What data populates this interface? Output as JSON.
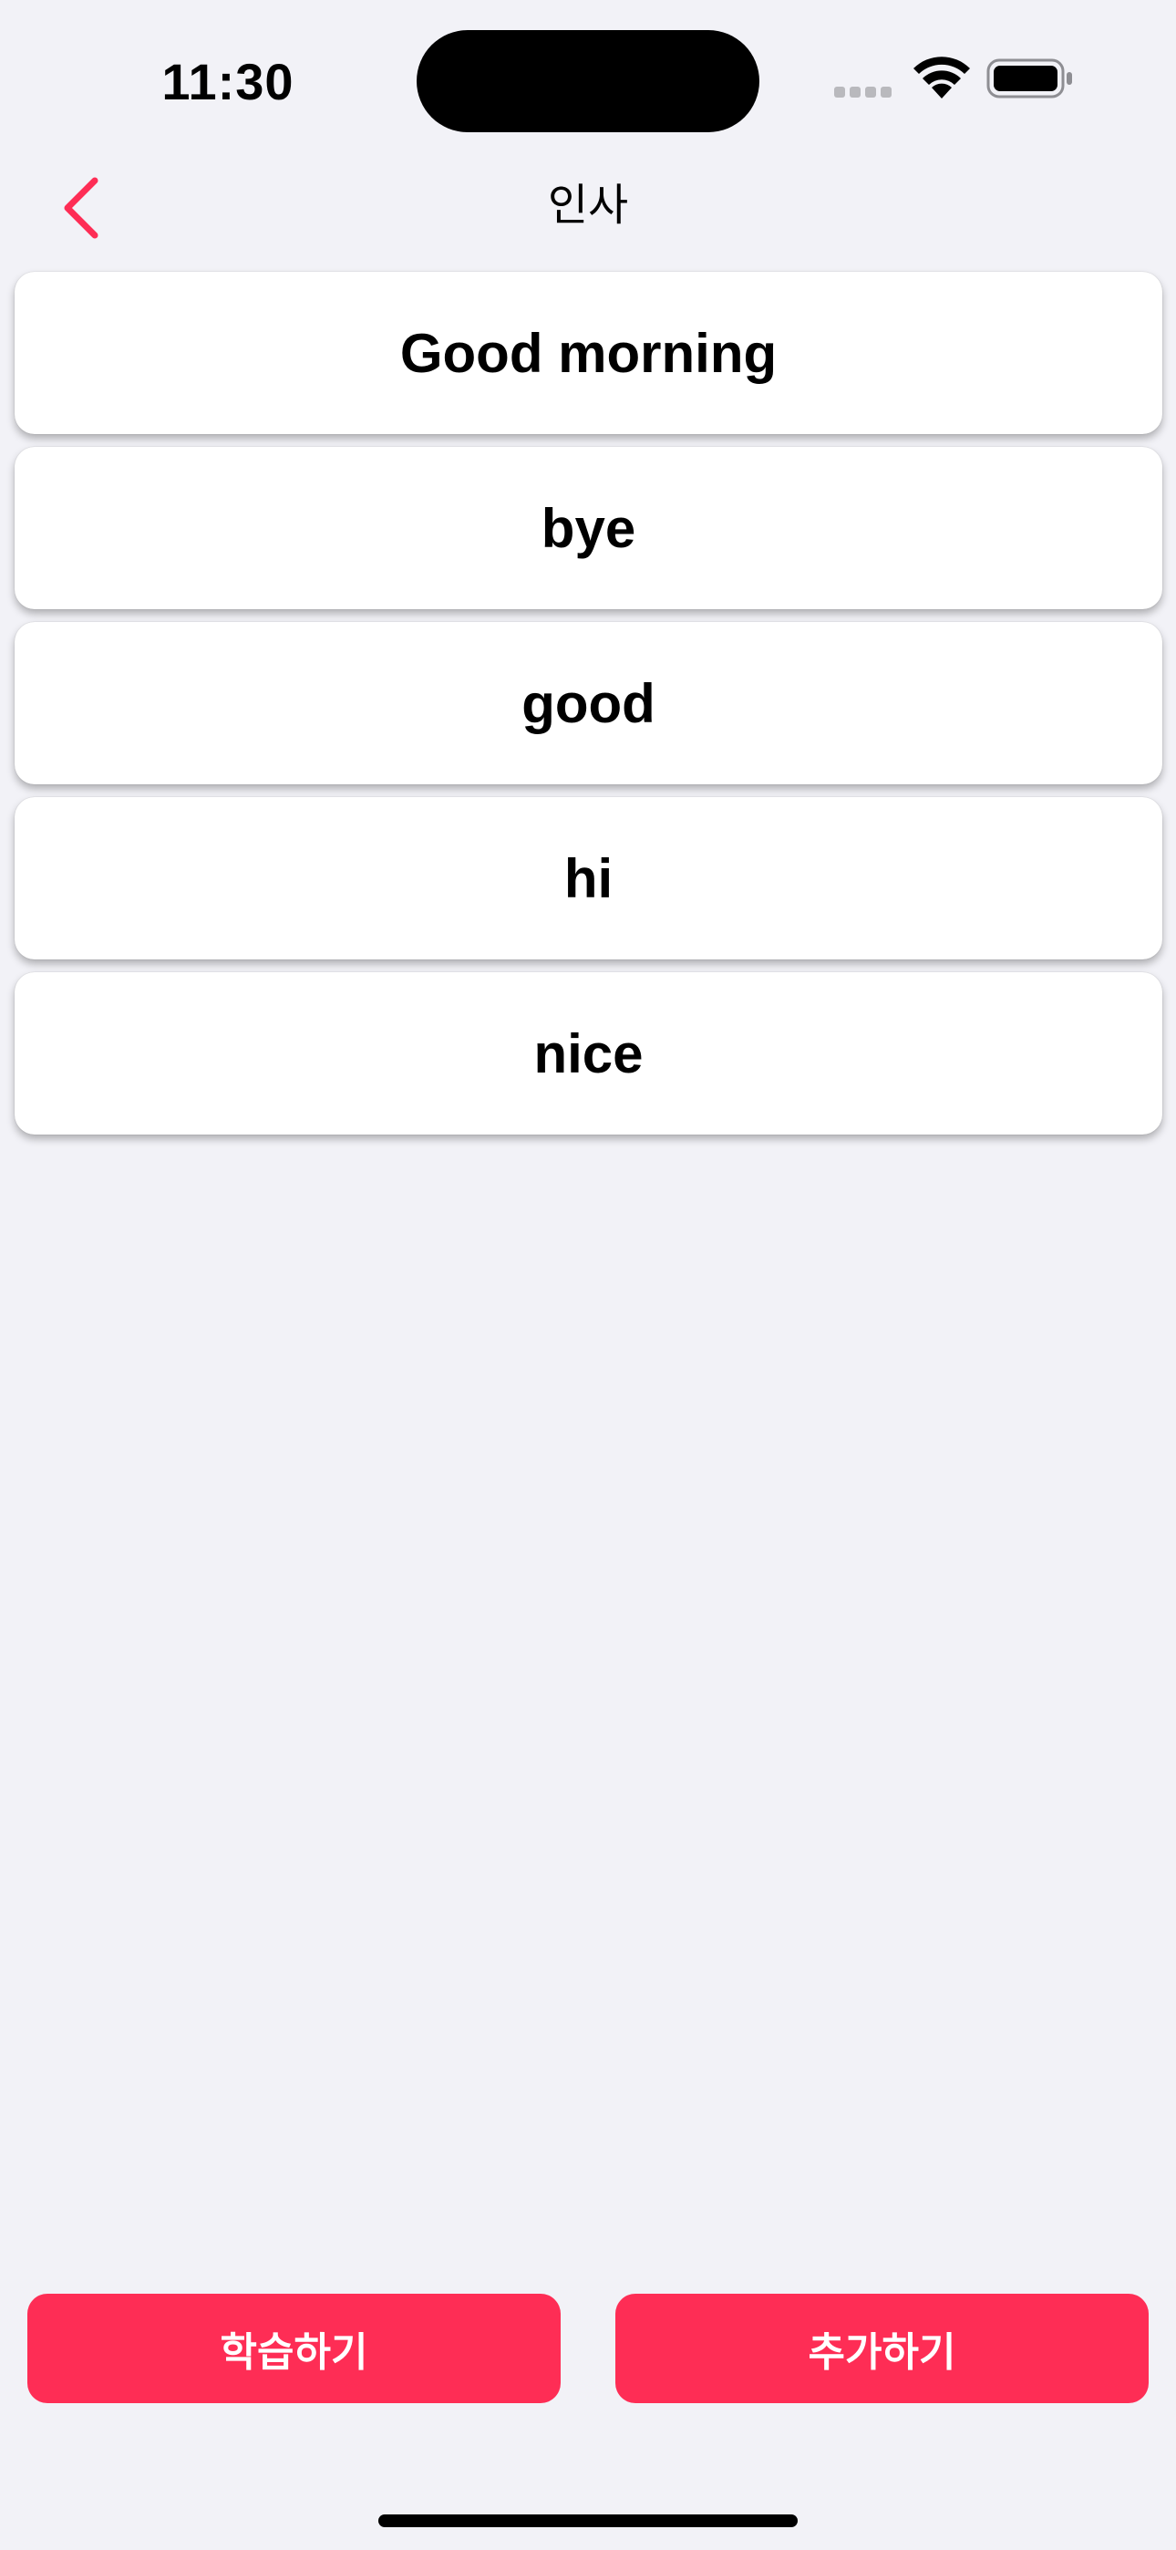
{
  "status_bar": {
    "time": "11:30",
    "signal_icon": "cellular-signal-icon",
    "wifi_icon": "wifi-icon",
    "battery_icon": "battery-icon"
  },
  "nav": {
    "back_icon": "chevron-left-icon",
    "title": "인사"
  },
  "words": [
    {
      "label": "Good morning"
    },
    {
      "label": "bye"
    },
    {
      "label": "good"
    },
    {
      "label": "hi"
    },
    {
      "label": "nice"
    }
  ],
  "actions": {
    "study_label": "학습하기",
    "add_label": "추가하기"
  },
  "colors": {
    "accent": "#fe2d55",
    "background": "#f2f2f7",
    "card": "#ffffff"
  }
}
